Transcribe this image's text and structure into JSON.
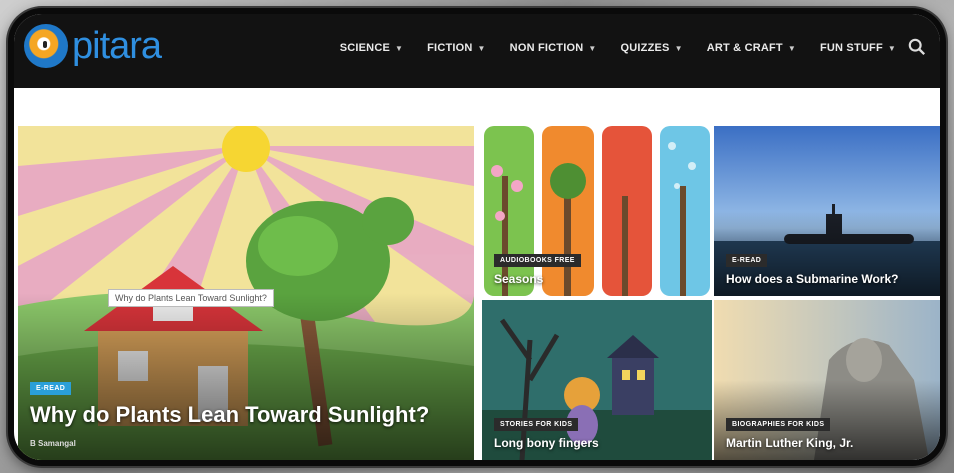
{
  "brand": {
    "name": "pitara"
  },
  "nav": [
    {
      "label": "SCIENCE"
    },
    {
      "label": "FICTION"
    },
    {
      "label": "NON FICTION"
    },
    {
      "label": "QUIZZES"
    },
    {
      "label": "ART & CRAFT"
    },
    {
      "label": "FUN STUFF"
    }
  ],
  "featured": {
    "badge": "E-READ",
    "title": "Why do Plants Lean Toward Sunlight?",
    "tooltip": "Why do Plants Lean Toward Sunlight?",
    "author": "B Samangal"
  },
  "tiles": [
    {
      "badge": "AUDIOBOOKS FREE",
      "title": "Seasons"
    },
    {
      "badge": "E-READ",
      "title": "How does a Submarine Work?"
    },
    {
      "badge": "STORIES FOR KIDS",
      "title": "Long bony fingers"
    },
    {
      "badge": "BIOGRAPHIES FOR KIDS",
      "title": "Martin Luther King, Jr."
    }
  ],
  "colors": {
    "header": "#121212",
    "accent": "#2a9fd8",
    "logo": "#2f8fe0"
  }
}
